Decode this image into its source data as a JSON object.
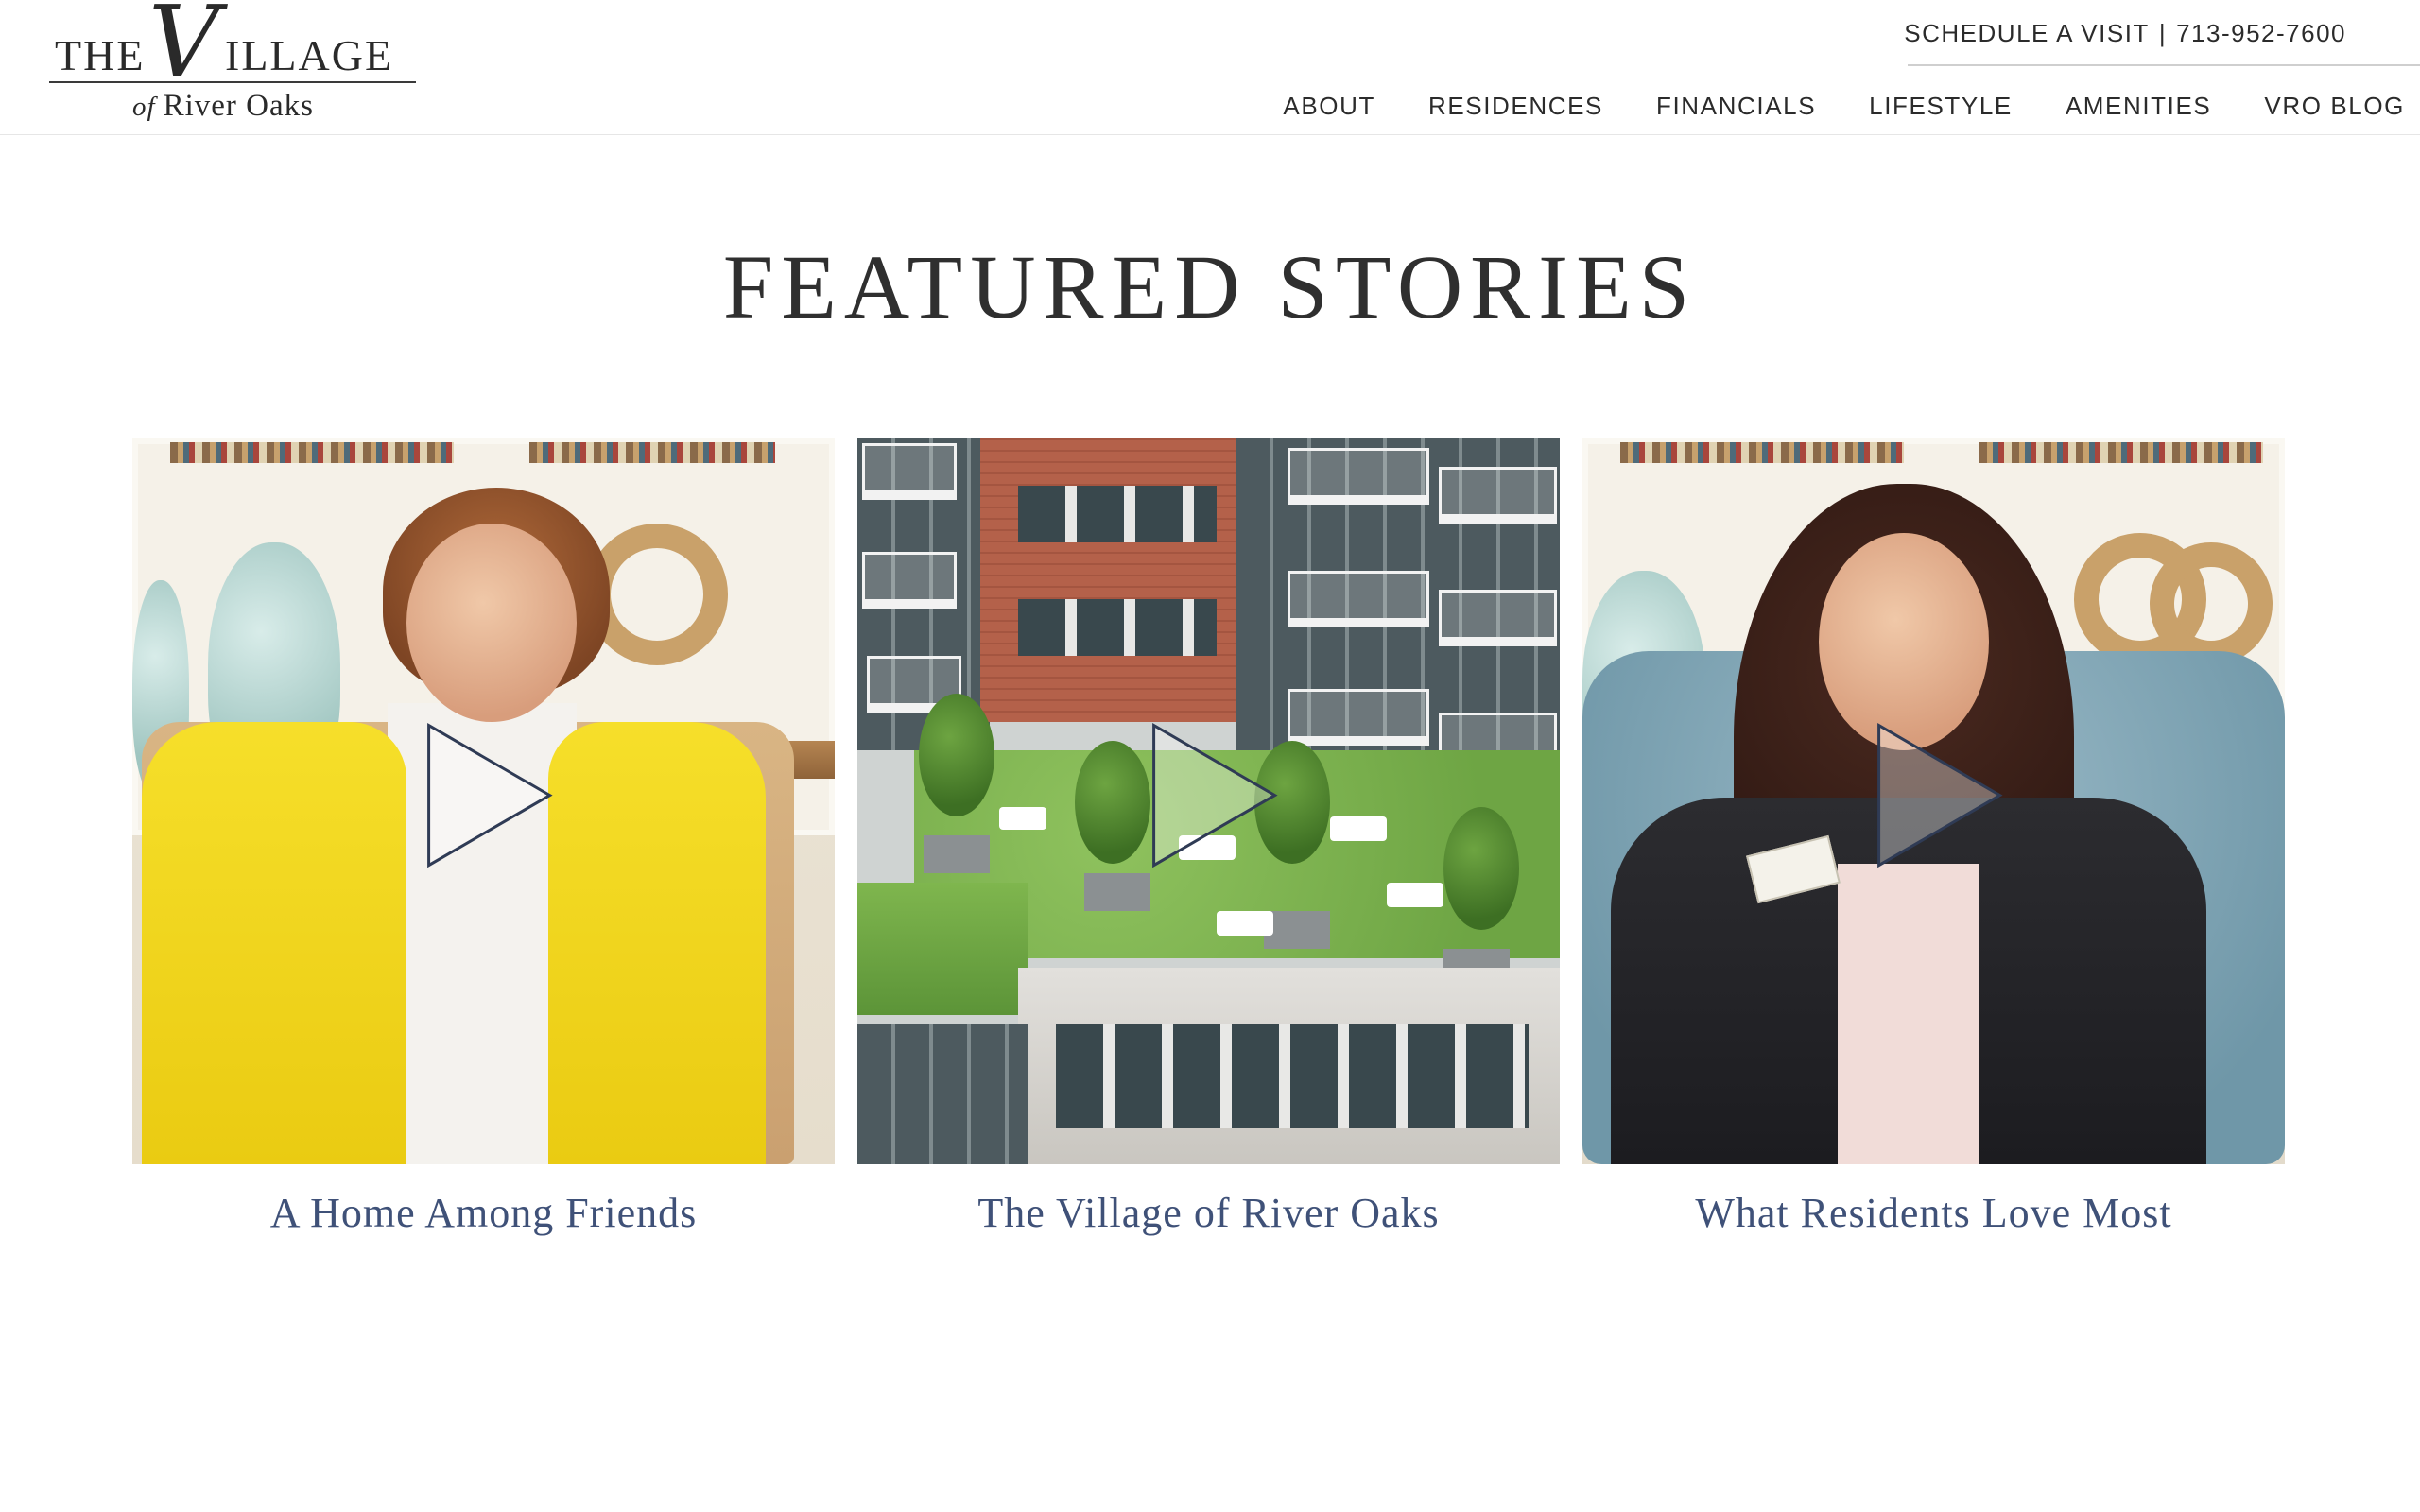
{
  "header": {
    "logo": {
      "line1_a": "THE",
      "line1_v": "V",
      "line1_b": "ILLAGE",
      "line2_of": "of",
      "line2_name": "River Oaks"
    },
    "schedule_visit": "SCHEDULE A VISIT",
    "separator": "|",
    "phone": "713-952-7600",
    "nav": [
      {
        "label": "ABOUT"
      },
      {
        "label": "RESIDENCES"
      },
      {
        "label": "FINANCIALS"
      },
      {
        "label": "LIFESTYLE"
      },
      {
        "label": "AMENITIES"
      },
      {
        "label": "VRO BLOG"
      }
    ]
  },
  "main": {
    "title": "FEATURED STORIES",
    "videos": [
      {
        "caption": "A Home Among Friends"
      },
      {
        "caption": "The Village of River Oaks"
      },
      {
        "caption": "What Residents Love Most"
      }
    ]
  },
  "colors": {
    "caption": "#3f5178",
    "text": "#2b2b2b",
    "background": "#ffffff"
  },
  "icons": [
    "play-icon"
  ]
}
